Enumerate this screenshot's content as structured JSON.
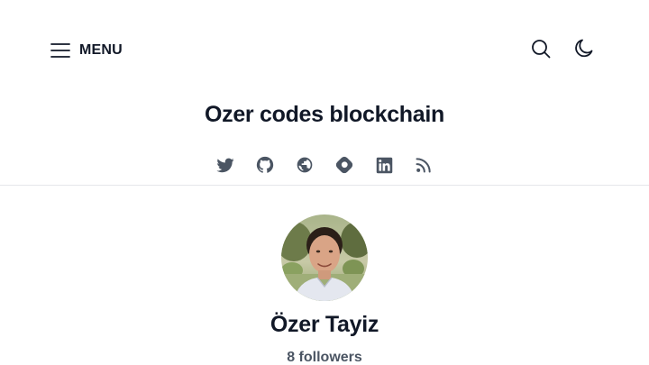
{
  "header": {
    "menu_label": "MENU",
    "menu_icon": "hamburger-icon",
    "search_icon": "search-icon",
    "theme_icon": "moon-icon"
  },
  "blog": {
    "title": "Ozer codes blockchain"
  },
  "social_links": [
    {
      "icon": "twitter-icon"
    },
    {
      "icon": "github-icon"
    },
    {
      "icon": "globe-icon"
    },
    {
      "icon": "hashnode-icon"
    },
    {
      "icon": "linkedin-icon"
    },
    {
      "icon": "rss-icon"
    }
  ],
  "author": {
    "name": "Özer Tayiz",
    "followers": "8 followers"
  },
  "colors": {
    "text_primary": "#111827",
    "text_secondary": "#4b5563",
    "icon": "#4b5563",
    "divider": "#e5e7eb",
    "background": "#ffffff"
  }
}
